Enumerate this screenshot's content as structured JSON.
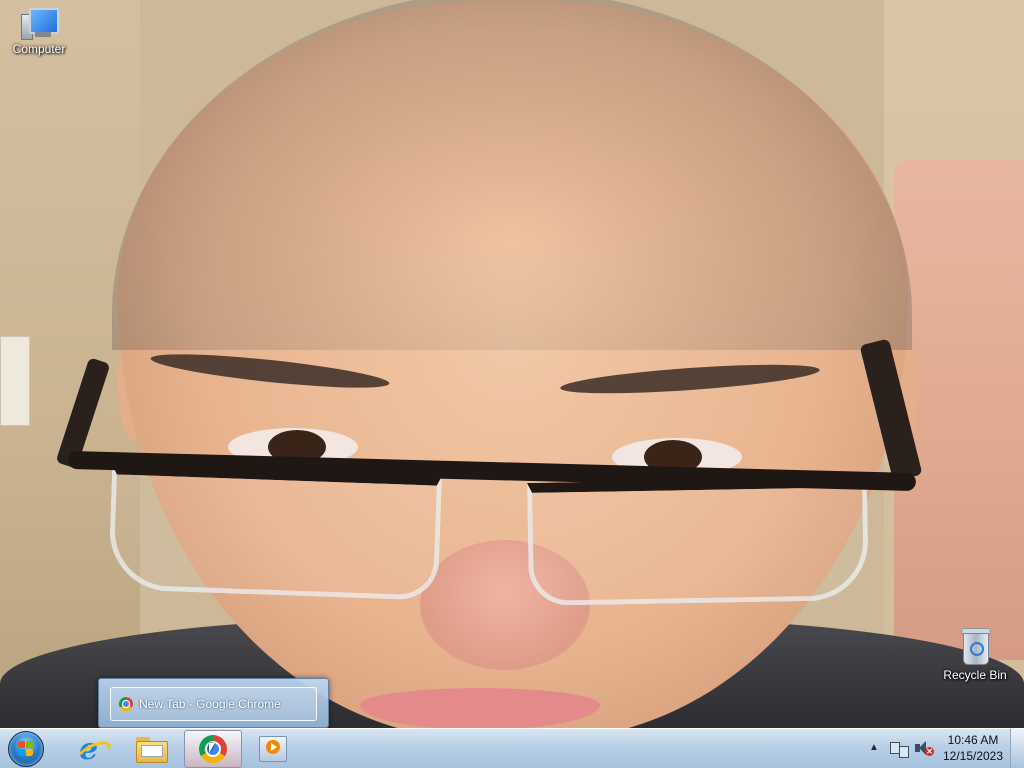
{
  "desktop": {
    "icons": [
      {
        "label": "Computer",
        "icon": "computer-icon"
      },
      {
        "label": "Recycle Bin",
        "icon": "recycle-bin-icon"
      }
    ]
  },
  "thumbnail_popup": {
    "label": "New Tab - Google Chrome",
    "icon": "chrome-icon"
  },
  "taskbar": {
    "start_icon": "windows-start-orb",
    "pinned": [
      {
        "name": "internet-explorer",
        "icon": "internet-explorer-icon"
      },
      {
        "name": "windows-explorer",
        "icon": "folder-icon"
      },
      {
        "name": "google-chrome",
        "icon": "chrome-icon",
        "active": true
      },
      {
        "name": "windows-media-player",
        "icon": "media-player-icon"
      }
    ]
  },
  "tray": {
    "chevron": "▲",
    "icons": [
      "network-icon",
      "volume-muted-icon"
    ],
    "time": "10:46 AM",
    "date": "12/15/2023"
  },
  "colors": {
    "taskbar": "#b9cfe6",
    "mute_badge": "#d9262a"
  }
}
